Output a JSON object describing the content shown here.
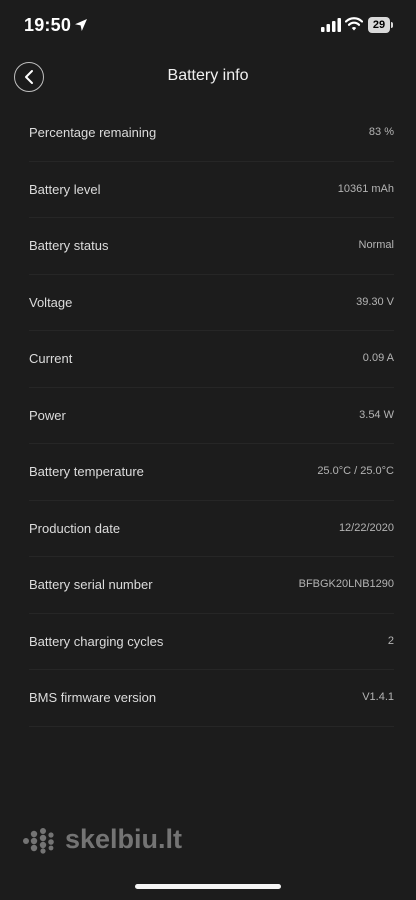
{
  "status_bar": {
    "time": "19:50",
    "battery_level": "29"
  },
  "header": {
    "title": "Battery info"
  },
  "rows": [
    {
      "label": "Percentage remaining",
      "value": "83 %"
    },
    {
      "label": "Battery level",
      "value": "10361 mAh"
    },
    {
      "label": "Battery status",
      "value": "Normal"
    },
    {
      "label": "Voltage",
      "value": "39.30 V"
    },
    {
      "label": "Current",
      "value": "0.09 A"
    },
    {
      "label": "Power",
      "value": "3.54 W"
    },
    {
      "label": "Battery temperature",
      "value": "25.0°C / 25.0°C"
    },
    {
      "label": "Production date",
      "value": "12/22/2020"
    },
    {
      "label": "Battery serial number",
      "value": "BFBGK20LNB1290"
    },
    {
      "label": "Battery charging cycles",
      "value": "2"
    },
    {
      "label": "BMS firmware version",
      "value": "V1.4.1"
    }
  ],
  "watermark": {
    "text": "skelbiu.lt"
  }
}
